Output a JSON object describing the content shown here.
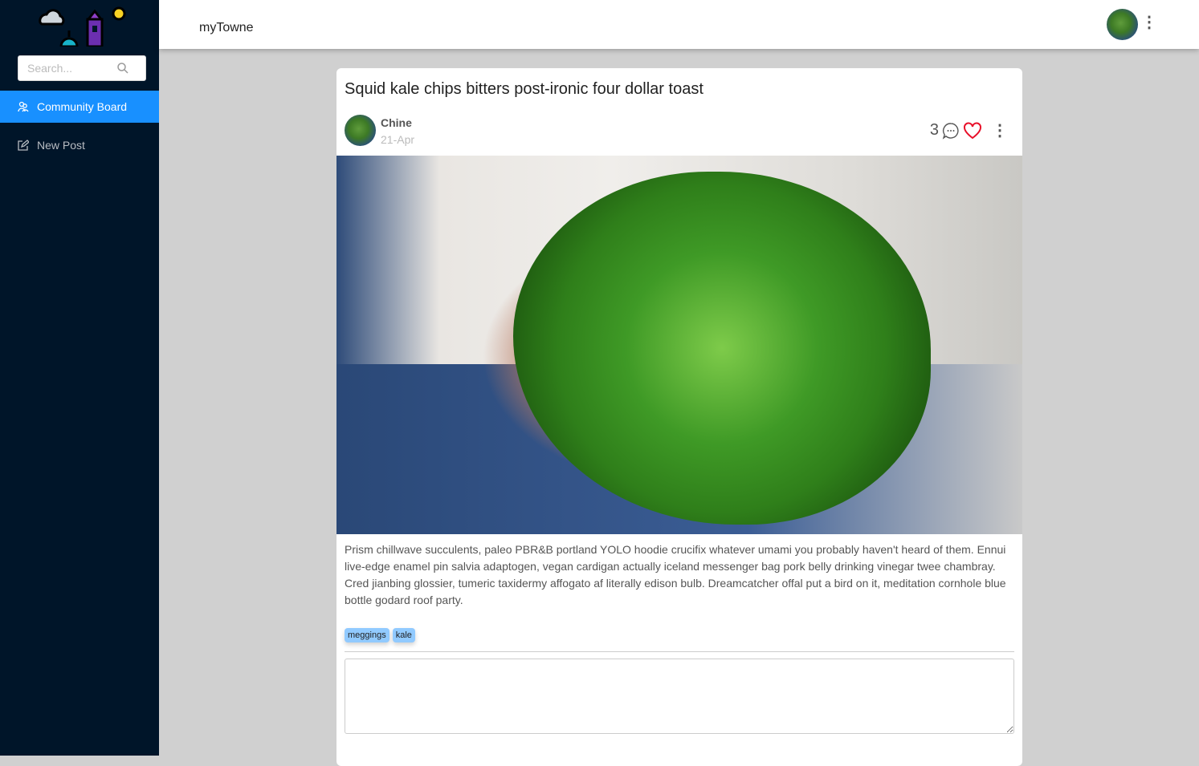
{
  "app": {
    "name": "myTowne"
  },
  "sidebar": {
    "search_placeholder": "Search...",
    "items": [
      {
        "label": "Community Board",
        "icon": "users-icon",
        "active": true
      },
      {
        "label": "New Post",
        "icon": "edit-icon",
        "active": false
      }
    ]
  },
  "post": {
    "title": "Squid kale chips bitters post-ironic four dollar toast",
    "author": "Chine",
    "date": "21-Apr",
    "comment_count": "3",
    "body": "Prism chillwave succulents, paleo PBR&B portland YOLO hoodie crucifix whatever umami you probably haven't heard of them. Ennui live-edge enamel pin salvia adaptogen, vegan cardigan actually iceland messenger bag pork belly drinking vinegar twee chambray. Cred jianbing glossier, tumeric taxidermy affogato af literally edison bulb. Dreamcatcher offal put a bird on it, meditation cornhole blue bottle godard roof party.",
    "tags": [
      "meggings",
      "kale"
    ],
    "comment_value": ""
  },
  "colors": {
    "sidebar": "#001529",
    "accent": "#1890ff",
    "heart": "#e8102a",
    "tag": "#91caff"
  }
}
